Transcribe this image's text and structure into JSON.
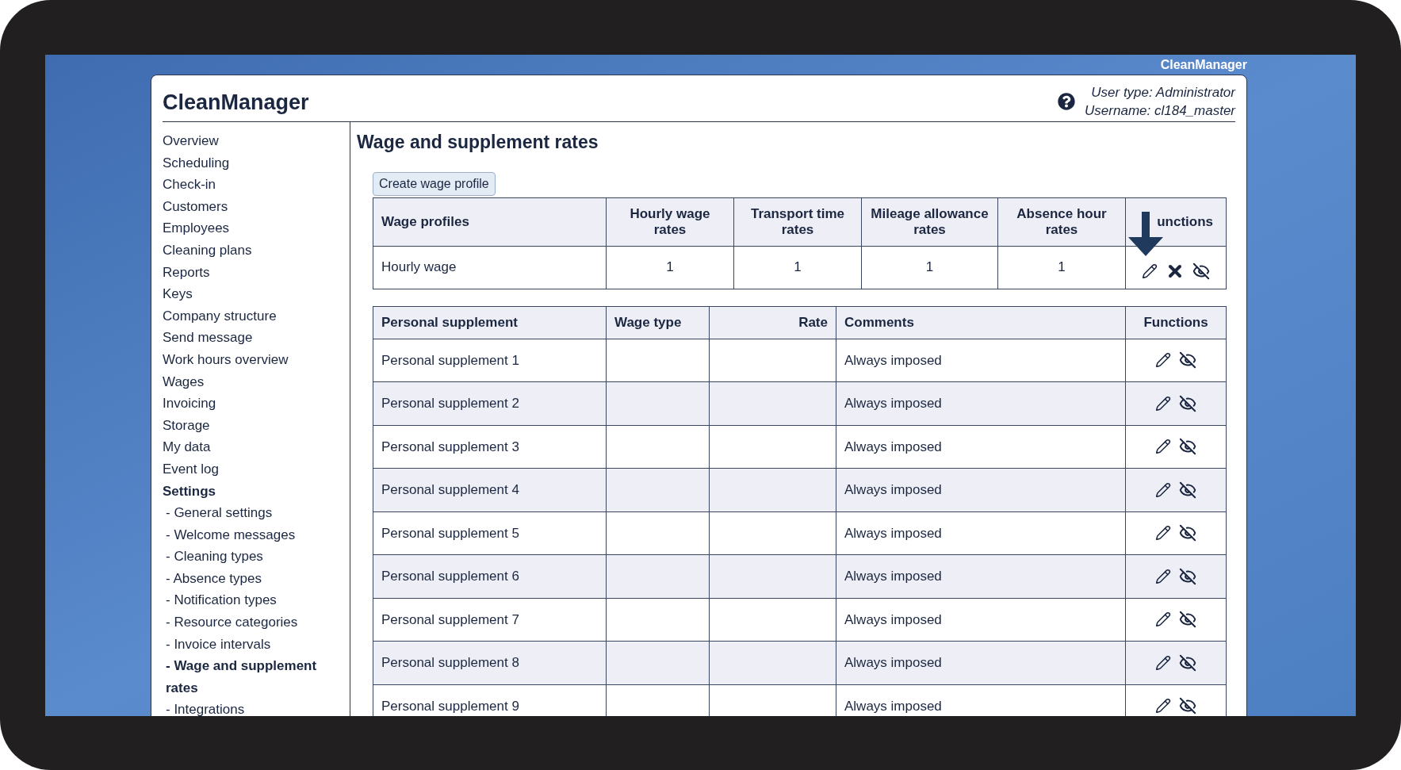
{
  "desktop": {
    "brand": "CleanManager"
  },
  "header": {
    "title": "CleanManager",
    "user_type": "User type: Administrator",
    "username": "Username: cl184_master"
  },
  "sidebar": {
    "items": [
      {
        "label": "Overview",
        "selected": false,
        "expanded": false
      },
      {
        "label": "Scheduling",
        "selected": false,
        "expanded": false
      },
      {
        "label": "Check-in",
        "selected": false,
        "expanded": false
      },
      {
        "label": "Customers",
        "selected": false,
        "expanded": false
      },
      {
        "label": "Employees",
        "selected": false,
        "expanded": false
      },
      {
        "label": "Cleaning plans",
        "selected": false,
        "expanded": false
      },
      {
        "label": "Reports",
        "selected": false,
        "expanded": false
      },
      {
        "label": "Keys",
        "selected": false,
        "expanded": false
      },
      {
        "label": "Company structure",
        "selected": false,
        "expanded": false
      },
      {
        "label": "Send message",
        "selected": false,
        "expanded": false
      },
      {
        "label": "Work hours overview",
        "selected": false,
        "expanded": false
      },
      {
        "label": "Wages",
        "selected": false,
        "expanded": false
      },
      {
        "label": "Invoicing",
        "selected": false,
        "expanded": false
      },
      {
        "label": "Storage",
        "selected": false,
        "expanded": false
      },
      {
        "label": "My data",
        "selected": false,
        "expanded": false
      },
      {
        "label": "Event log",
        "selected": false,
        "expanded": false
      },
      {
        "label": "Settings",
        "selected": false,
        "expanded": true,
        "children": [
          {
            "label": "- General settings",
            "selected": false
          },
          {
            "label": "- Welcome messages",
            "selected": false
          },
          {
            "label": "- Cleaning types",
            "selected": false
          },
          {
            "label": "- Absence types",
            "selected": false
          },
          {
            "label": "- Notification types",
            "selected": false
          },
          {
            "label": "- Resource categories",
            "selected": false
          },
          {
            "label": "- Invoice intervals",
            "selected": false
          },
          {
            "label": "- Wage and supplement rates",
            "selected": true
          },
          {
            "label": "- Integrations",
            "selected": false
          }
        ]
      }
    ]
  },
  "page": {
    "title": "Wage and supplement rates",
    "create_button": "Create wage profile"
  },
  "wage_table": {
    "columns": [
      "Wage profiles",
      "Hourly wage rates",
      "Transport time rates",
      "Mileage allowance rates",
      "Absence hour rates",
      "unctions"
    ],
    "rows": [
      {
        "cells": [
          "Hourly wage",
          "1",
          "1",
          "1",
          "1"
        ],
        "actions": [
          {
            "kind": "edit"
          },
          {
            "kind": "delete"
          },
          {
            "kind": "hide"
          }
        ]
      }
    ]
  },
  "supplement_table": {
    "columns": [
      "Personal supplement",
      "Wage type",
      "Rate",
      "Comments",
      "Functions"
    ],
    "rows": [
      {
        "cells": [
          "Personal supplement 1",
          "",
          "",
          "Always imposed"
        ],
        "actions": [
          {
            "kind": "edit"
          },
          {
            "kind": "hide"
          }
        ]
      },
      {
        "cells": [
          "Personal supplement 2",
          "",
          "",
          "Always imposed"
        ],
        "actions": [
          {
            "kind": "edit"
          },
          {
            "kind": "hide"
          }
        ]
      },
      {
        "cells": [
          "Personal supplement 3",
          "",
          "",
          "Always imposed"
        ],
        "actions": [
          {
            "kind": "edit"
          },
          {
            "kind": "hide"
          }
        ]
      },
      {
        "cells": [
          "Personal supplement 4",
          "",
          "",
          "Always imposed"
        ],
        "actions": [
          {
            "kind": "edit"
          },
          {
            "kind": "hide"
          }
        ]
      },
      {
        "cells": [
          "Personal supplement 5",
          "",
          "",
          "Always imposed"
        ],
        "actions": [
          {
            "kind": "edit"
          },
          {
            "kind": "hide"
          }
        ]
      },
      {
        "cells": [
          "Personal supplement 6",
          "",
          "",
          "Always imposed"
        ],
        "actions": [
          {
            "kind": "edit"
          },
          {
            "kind": "hide"
          }
        ]
      },
      {
        "cells": [
          "Personal supplement 7",
          "",
          "",
          "Always imposed"
        ],
        "actions": [
          {
            "kind": "edit"
          },
          {
            "kind": "hide"
          }
        ]
      },
      {
        "cells": [
          "Personal supplement 8",
          "",
          "",
          "Always imposed"
        ],
        "actions": [
          {
            "kind": "edit"
          },
          {
            "kind": "hide"
          }
        ]
      },
      {
        "cells": [
          "Personal supplement 9",
          "",
          "",
          "Always imposed"
        ],
        "actions": [
          {
            "kind": "edit"
          },
          {
            "kind": "hide"
          }
        ]
      }
    ]
  }
}
